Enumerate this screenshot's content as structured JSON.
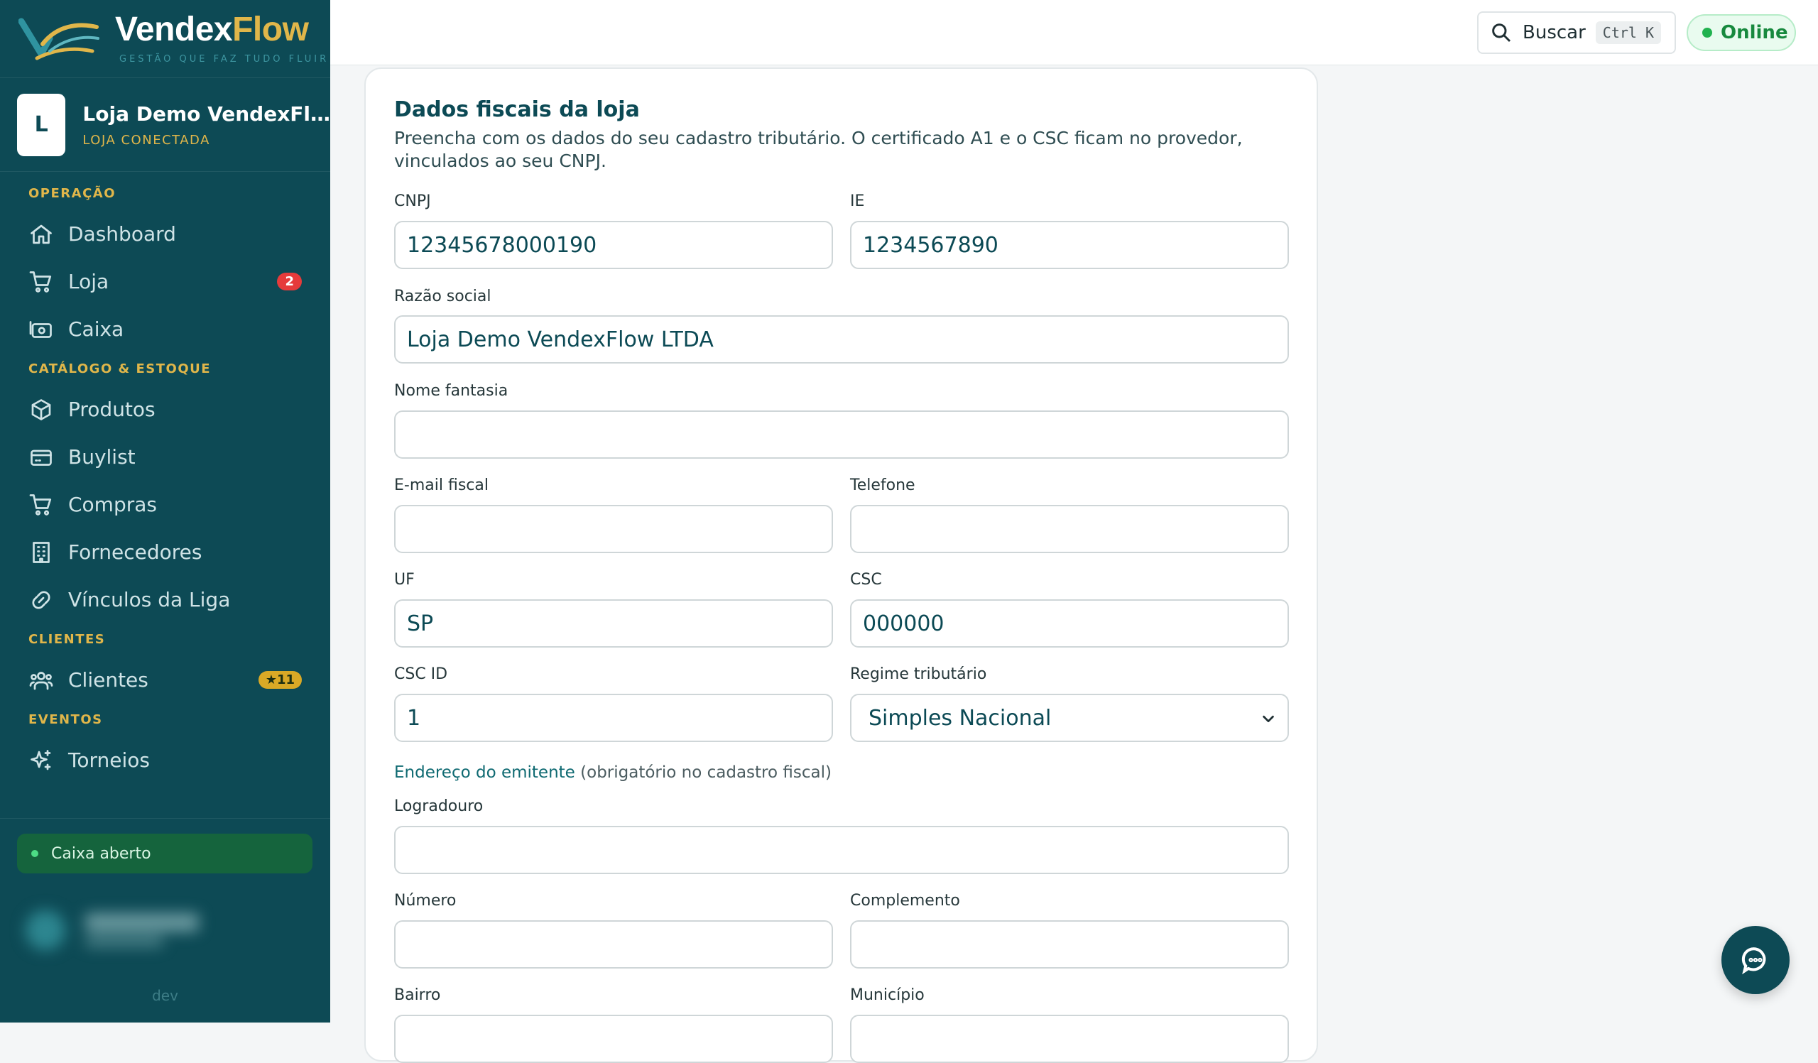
{
  "brand": {
    "name_part1": "Vendex",
    "name_part2": "Flow",
    "tagline": "GESTÃO QUE FAZ TUDO FLUIR"
  },
  "store": {
    "avatar_letter": "L",
    "name": "Loja Demo VendexFl…",
    "status": "LOJA CONECTADA"
  },
  "sidebar": {
    "sections": [
      {
        "title": "OPERAÇÃO",
        "items": [
          {
            "label": "Dashboard",
            "icon": "home-icon"
          },
          {
            "label": "Loja",
            "icon": "cart-icon",
            "badge": "2"
          },
          {
            "label": "Caixa",
            "icon": "cash-register-icon"
          }
        ]
      },
      {
        "title": "CATÁLOGO & ESTOQUE",
        "items": [
          {
            "label": "Produtos",
            "icon": "box-icon"
          },
          {
            "label": "Buylist",
            "icon": "card-icon"
          },
          {
            "label": "Compras",
            "icon": "cart-icon"
          },
          {
            "label": "Fornecedores",
            "icon": "building-icon"
          },
          {
            "label": "Vínculos da Liga",
            "icon": "link-icon"
          }
        ]
      },
      {
        "title": "CLIENTES",
        "items": [
          {
            "label": "Clientes",
            "icon": "users-icon",
            "badge": "★11"
          }
        ]
      },
      {
        "title": "EVENTOS",
        "items": [
          {
            "label": "Torneios",
            "icon": "sparkle-icon"
          }
        ]
      }
    ],
    "cash_status": "Caixa aberto",
    "env": "dev"
  },
  "topbar": {
    "search_label": "Buscar",
    "shortcut": "Ctrl K",
    "status": "Online"
  },
  "form": {
    "title": "Dados fiscais da loja",
    "description": "Preencha com os dados do seu cadastro tributário. O certificado A1 e o CSC ficam no provedor, vinculados ao seu CNPJ.",
    "fields": {
      "cnpj": {
        "label": "CNPJ",
        "value": "12345678000190"
      },
      "ie": {
        "label": "IE",
        "value": "1234567890"
      },
      "razao_social": {
        "label": "Razão social",
        "value": "Loja Demo VendexFlow LTDA"
      },
      "nome_fantasia": {
        "label": "Nome fantasia",
        "value": ""
      },
      "email_fiscal": {
        "label": "E-mail fiscal",
        "value": ""
      },
      "telefone": {
        "label": "Telefone",
        "value": ""
      },
      "uf": {
        "label": "UF",
        "value": "SP"
      },
      "csc": {
        "label": "CSC",
        "value": "000000"
      },
      "csc_id": {
        "label": "CSC ID",
        "value": "1"
      },
      "regime": {
        "label": "Regime tributário",
        "value": "Simples Nacional"
      },
      "logradouro": {
        "label": "Logradouro",
        "value": ""
      },
      "numero": {
        "label": "Número",
        "value": ""
      },
      "complemento": {
        "label": "Complemento",
        "value": ""
      },
      "bairro": {
        "label": "Bairro",
        "value": ""
      },
      "municipio": {
        "label": "Município",
        "value": ""
      }
    },
    "address_heading": "Endereço do emitente",
    "address_note": "(obrigatório no cadastro fiscal)"
  },
  "colors": {
    "sidebar_bg": "#0d4a55",
    "accent_gold": "#e0b64a",
    "online_green": "#21b24f",
    "badge_red": "#e53b3b"
  }
}
